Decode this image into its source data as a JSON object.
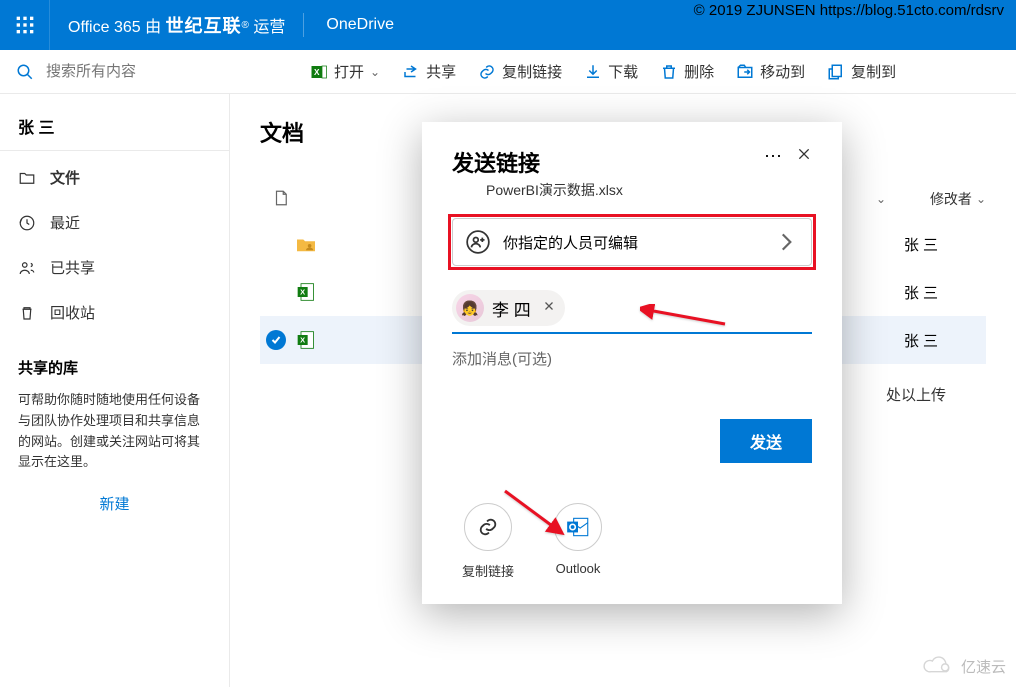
{
  "copyright": "© 2019 ZJUNSEN https://blog.51cto.com/rdsrv",
  "header": {
    "brand_prefix": "Office 365 由",
    "brand_bold": "世纪互联",
    "brand_suffix": "运营",
    "app": "OneDrive"
  },
  "search": {
    "placeholder": "搜索所有内容"
  },
  "toolbar": {
    "open": "打开",
    "share": "共享",
    "copylink": "复制链接",
    "download": "下载",
    "delete": "删除",
    "moveto": "移动到",
    "copyto": "复制到"
  },
  "sidebar": {
    "user": "张 三",
    "items": [
      {
        "icon": "folder",
        "label": "文件",
        "active": true
      },
      {
        "icon": "recent",
        "label": "最近"
      },
      {
        "icon": "shared",
        "label": "已共享"
      },
      {
        "icon": "recycle",
        "label": "回收站"
      }
    ],
    "lib_title": "共享的库",
    "lib_desc": "可帮助你随时随地使用任何设备与团队协作处理项目和共享信息的网站。创建或关注网站可将其显示在这里。",
    "new": "新建"
  },
  "main": {
    "breadcrumb": "文档",
    "col_modby": "修改者",
    "rows": [
      {
        "modby": "张 三"
      },
      {
        "modby": "张 三"
      },
      {
        "modby": "张 三",
        "selected": true
      }
    ],
    "upload_hint": "处以上传"
  },
  "dialog": {
    "title": "发送链接",
    "file": "PowerBI演示数据.xlsx",
    "scope": "你指定的人员可编辑",
    "chip_name": "李 四",
    "message_placeholder": "添加消息(可选)",
    "send": "发送",
    "targets": {
      "copylink": "复制链接",
      "outlook": "Outlook"
    }
  },
  "watermark": "亿速云"
}
